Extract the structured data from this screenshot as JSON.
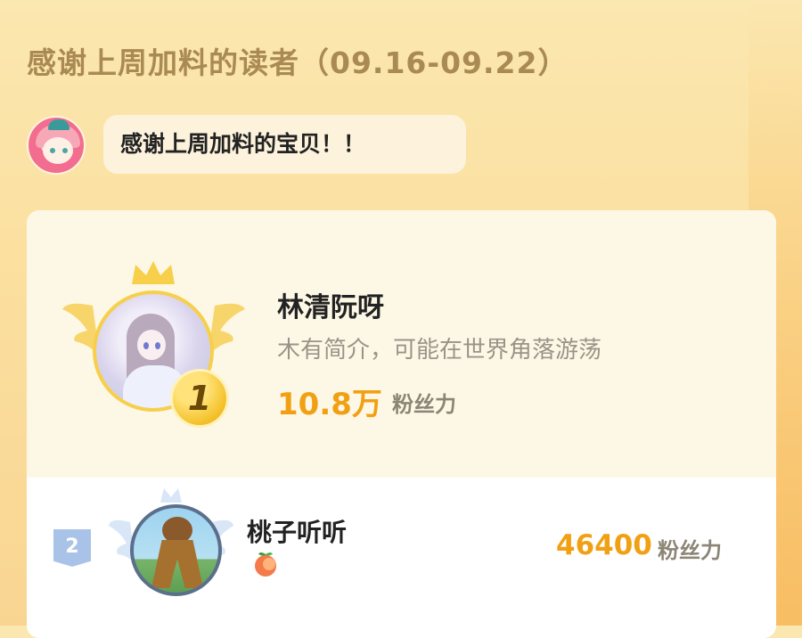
{
  "header": {
    "title": "感谢上周加料的读者（09.16-09.22）"
  },
  "message": {
    "text": "感谢上周加料的宝贝！！"
  },
  "ranking": [
    {
      "rank": "1",
      "name": "林清阮呀",
      "bio": "木有简介，可能在世界角落游荡",
      "fans_value": "10.8万",
      "fans_label": "粉丝力"
    },
    {
      "rank": "2",
      "name": "桃子听听",
      "badge_icon": "peach-emoji-icon",
      "fans_value": "46400",
      "fans_label": "粉丝力"
    }
  ],
  "colors": {
    "accent": "#f2a013",
    "title": "#a98a52",
    "background": "#fbe0a0"
  }
}
